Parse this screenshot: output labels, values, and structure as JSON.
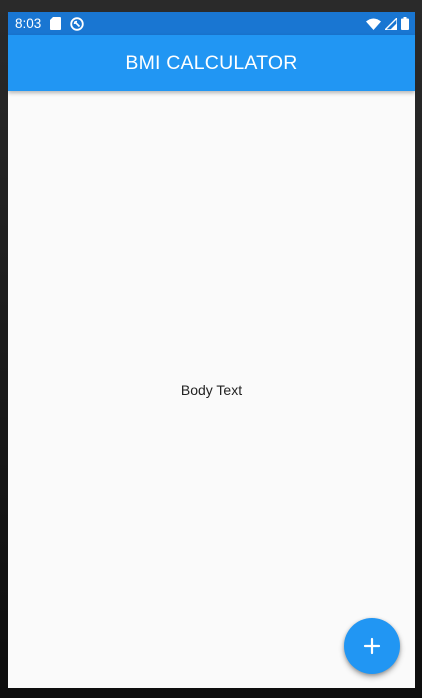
{
  "status_bar": {
    "time": "8:03",
    "left_icons": [
      "sd-card-icon",
      "sync-circle-icon"
    ],
    "right_icons": [
      "wifi-icon",
      "signal-icon",
      "battery-icon"
    ],
    "background_color": "#1976d2"
  },
  "app_bar": {
    "title": "BMI CALCULATOR",
    "background_color": "#2196f3"
  },
  "body": {
    "text": "Body Text"
  },
  "fab": {
    "icon": "plus-icon",
    "background_color": "#2196f3"
  }
}
